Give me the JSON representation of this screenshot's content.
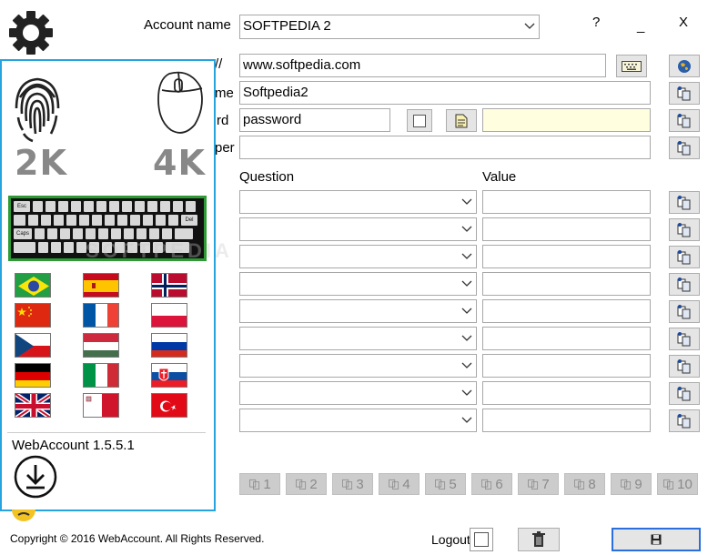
{
  "header": {
    "account_label": "Account name",
    "account_value": "SOFTPEDIA 2",
    "help": "?",
    "minimize": "_",
    "close": "X"
  },
  "fields": {
    "url_label_fragment": "//",
    "url_value": "www.softpedia.com",
    "username_label_fragment": "me",
    "username_value": "Softpedia2",
    "password_label_fragment": "rd",
    "password_value": "password",
    "password_extra": "",
    "number_label_fragment": "per",
    "number_value": ""
  },
  "qa": {
    "question_header": "Question",
    "value_header": "Value",
    "rows": [
      {
        "question": "",
        "value": ""
      },
      {
        "question": "",
        "value": ""
      },
      {
        "question": "",
        "value": ""
      },
      {
        "question": "",
        "value": ""
      },
      {
        "question": "",
        "value": ""
      },
      {
        "question": "",
        "value": ""
      },
      {
        "question": "",
        "value": ""
      },
      {
        "question": "",
        "value": ""
      },
      {
        "question": "",
        "value": ""
      }
    ]
  },
  "slots": [
    "1",
    "2",
    "3",
    "4",
    "5",
    "6",
    "7",
    "8",
    "9",
    "10"
  ],
  "panel": {
    "fingerprint_label": "2K",
    "mouse_label": "4K",
    "keyboard_keys": {
      "esc": "Esc",
      "del": "Del",
      "caps": "Caps",
      "ctrl": "Ctrl",
      "alt": "Alt",
      "altgr": "Alt",
      "ctrl_r": "Ctrl"
    },
    "watermark": "SOFTPEDIA",
    "flags": [
      "brazil",
      "spain",
      "norway",
      "china",
      "france",
      "poland",
      "czech",
      "hungary",
      "russia",
      "germany",
      "italy",
      "slovakia",
      "united-kingdom",
      "malta",
      "turkey"
    ],
    "version": "WebAccount 1.5.5.1"
  },
  "footer": {
    "copyright": "Copyright © 2016 WebAccount. All Rights Reserved.",
    "logout_label": "Logout"
  },
  "colors": {
    "panel_border": "#27a4e0",
    "keyboard_bg": "#2e9a35",
    "password_extra_bg": "#ffffe0",
    "disabled_button": "#cccccc"
  }
}
